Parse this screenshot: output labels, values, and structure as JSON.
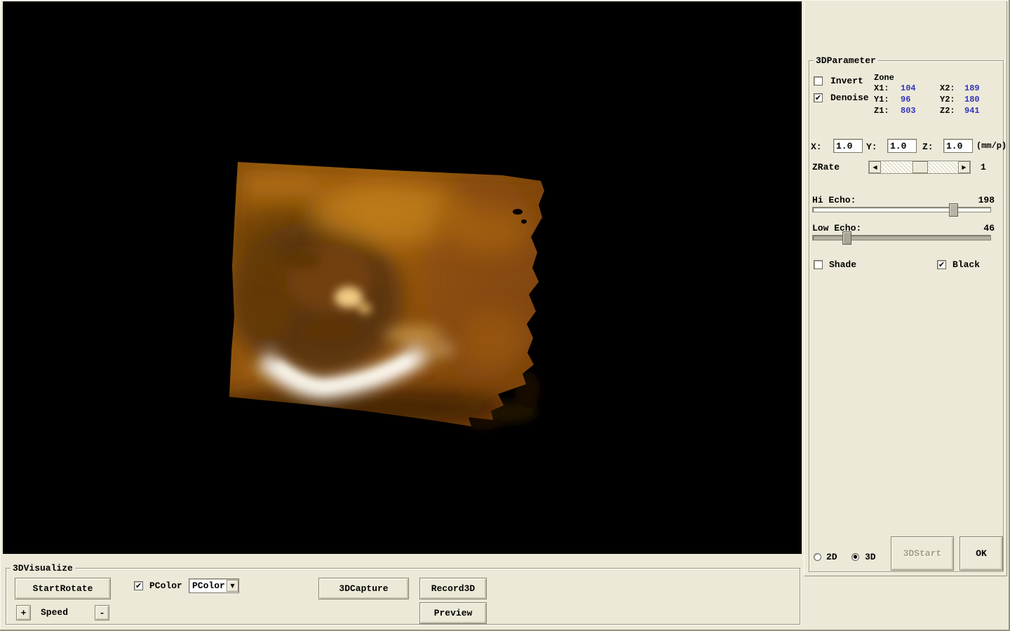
{
  "colors": {
    "window_bg": "#ece9d8",
    "viewport_bg": "#000000",
    "value_text": "#3333bb",
    "disabled_text": "#a09d86",
    "volume_base": "#a3600f",
    "volume_dark": "#4f2d08",
    "volume_highlight": "#ffffff"
  },
  "glyphs": {
    "check": "✔",
    "radio_dot": "●",
    "combo_arrow": "▼",
    "scroll_left": "◀",
    "scroll_right": "▶"
  },
  "parameter_panel": {
    "group_label": "3DParameter",
    "invert": {
      "label": "Invert",
      "checked": false
    },
    "denoise": {
      "label": "Denoise",
      "checked": true
    },
    "zone": {
      "label": "Zone",
      "x1_label": "X1:",
      "x1": "104",
      "x2_label": "X2:",
      "x2": "189",
      "y1_label": "Y1:",
      "y1": "96",
      "y2_label": "Y2:",
      "y2": "180",
      "z1_label": "Z1:",
      "z1": "803",
      "z2_label": "Z2:",
      "z2": "941"
    },
    "scale": {
      "x_label": "X:",
      "x_value": "1.0",
      "y_label": "Y:",
      "y_value": "1.0",
      "z_label": "Z:",
      "z_value": "1.0",
      "unit": "(mm/p)"
    },
    "zrate": {
      "label": "ZRate",
      "value": "1"
    },
    "hi_echo": {
      "label": "Hi Echo:",
      "value": "198"
    },
    "low_echo": {
      "label": "Low Echo:",
      "value": "46"
    },
    "shade": {
      "label": "Shade",
      "checked": false
    },
    "black": {
      "label": "Black",
      "checked": true
    },
    "mode_2d_label": "2D",
    "mode_3d_label": "3D",
    "mode_selected": "3D",
    "start3d_label": "3DStart",
    "ok_label": "OK"
  },
  "visualize_panel": {
    "group_label": "3DVisualize",
    "start_rotate_label": "StartRotate",
    "pcolor_check_label": "PColor",
    "pcolor_select_value": "PColor",
    "capture_label": "3DCapture",
    "record_label": "Record3D",
    "preview_label": "Preview",
    "speed_plus_label": "+",
    "speed_label": "Speed",
    "speed_minus_label": "-"
  }
}
